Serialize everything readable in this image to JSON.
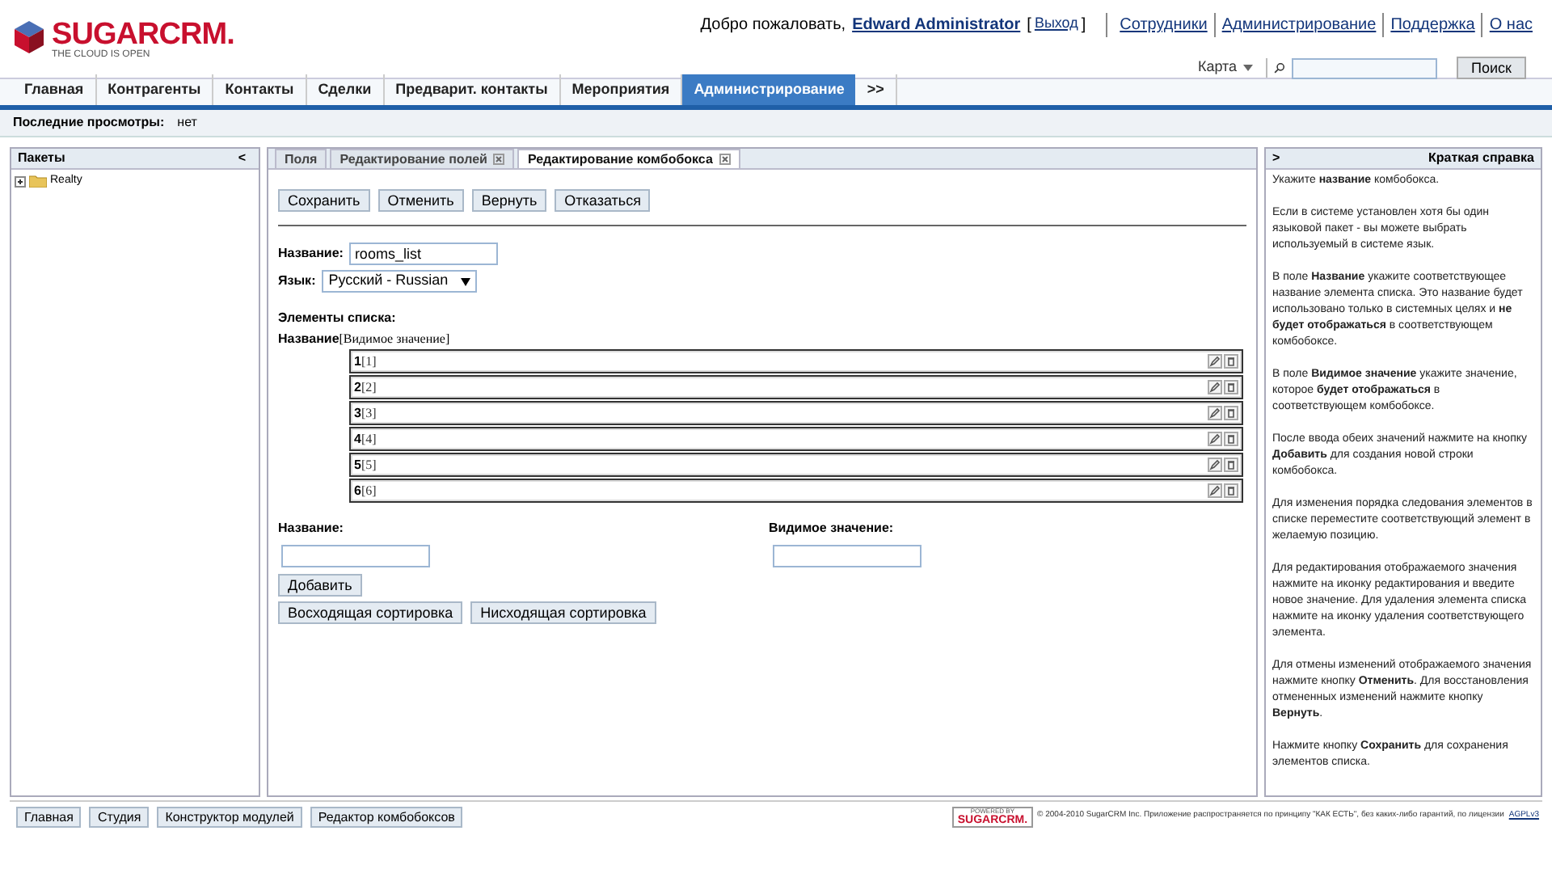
{
  "header": {
    "logo": {
      "name": "SUGARCRM.",
      "tagline": "THE CLOUD IS OPEN"
    },
    "welcome": "Добро пожаловать,",
    "user": "Edward Administrator",
    "logout_open": "[",
    "logout": "Выход",
    "logout_close": "]",
    "links": [
      "Сотрудники",
      "Администрирование",
      "Поддержка",
      "О нас"
    ],
    "map_menu": "Карта",
    "search_button": "Поиск"
  },
  "nav_tabs": [
    {
      "label": "Главная",
      "selected": false
    },
    {
      "label": "Контрагенты",
      "selected": false
    },
    {
      "label": "Контакты",
      "selected": false
    },
    {
      "label": "Сделки",
      "selected": false
    },
    {
      "label": "Предварит. контакты",
      "selected": false
    },
    {
      "label": "Мероприятия",
      "selected": false
    },
    {
      "label": "Администрирование",
      "selected": true
    },
    {
      "label": ">>",
      "selected": false
    }
  ],
  "recent": {
    "label": "Последние просмотры:",
    "value": "нет"
  },
  "packages": {
    "title": "Пакеты",
    "collapse": "<",
    "tree": [
      {
        "label": "Realty",
        "expanded": false
      }
    ]
  },
  "editor_tabs": [
    {
      "label": "Поля",
      "closable": false,
      "selected": false
    },
    {
      "label": "Редактирование полей",
      "closable": true,
      "selected": false
    },
    {
      "label": "Редактирование комбобокса",
      "closable": true,
      "selected": true
    }
  ],
  "actions": [
    "Сохранить",
    "Отменить",
    "Вернуть",
    "Отказаться"
  ],
  "name_field": {
    "label": "Название:",
    "value": "rooms_list"
  },
  "language": {
    "label": "Язык:",
    "value": "Русский - Russian"
  },
  "items_title": "Элементы списка:",
  "items_header": {
    "name": "Название",
    "display": "[Видимое значение]"
  },
  "items": [
    {
      "name": "1",
      "display": "[1]"
    },
    {
      "name": "2",
      "display": "[2]"
    },
    {
      "name": "3",
      "display": "[3]"
    },
    {
      "name": "4",
      "display": "[4]"
    },
    {
      "name": "5",
      "display": "[5]"
    },
    {
      "name": "6",
      "display": "[6]"
    }
  ],
  "new_item": {
    "name_label": "Название:",
    "display_label": "Видимое значение:",
    "add_button": "Добавить"
  },
  "sort_buttons": [
    "Восходящая сортировка",
    "Нисходящая сортировка"
  ],
  "help": {
    "expand": ">",
    "title": "Краткая справка",
    "paragraphs": [
      "Укажите **название** комбобокса.",
      "Если в системе установлен хотя бы один языковой пакет - вы можете выбрать используемый в системе язык.",
      "В поле **Название** укажите соответствующее название элемента списка. Это название будет использовано только в системных целях и **не будет отображаться** в соответствующем комбобоксе.",
      "В поле **Видимое значение** укажите значение, которое **будет отображаться** в соответствующем комбобоксе.",
      "После ввода обеих значений нажмите на кнопку **Добавить** для создания новой строки комбобокса.",
      "Для изменения порядка следования элементов в списке переместите соответствующий элемент в желаемую позицию.",
      "Для редактирования отображаемого значения нажмите на иконку редактирования и введите новое значение. Для удаления элемента списка нажмите на иконку удаления соответствующего элемента.",
      "Для отмены изменений отображаемого значения нажмите кнопку **Отменить**. Для восстановления отмененных изменений нажмите кнопку **Вернуть**.",
      "Нажмите кнопку **Сохранить** для сохранения элементов списка."
    ]
  },
  "footer": {
    "tabs": [
      "Главная",
      "Студия",
      "Конструктор модулей",
      "Редактор комбобоксов"
    ],
    "powered_by": "POWERED BY",
    "powered_logo": "SUGARCRM.",
    "copyright": "© 2004-2010 SugarCRM Inc. Приложение распространяется по принципу \"КАК ЕСТЬ\", без каких-либо гарантий, по лицензии",
    "license": "AGPLv3"
  }
}
